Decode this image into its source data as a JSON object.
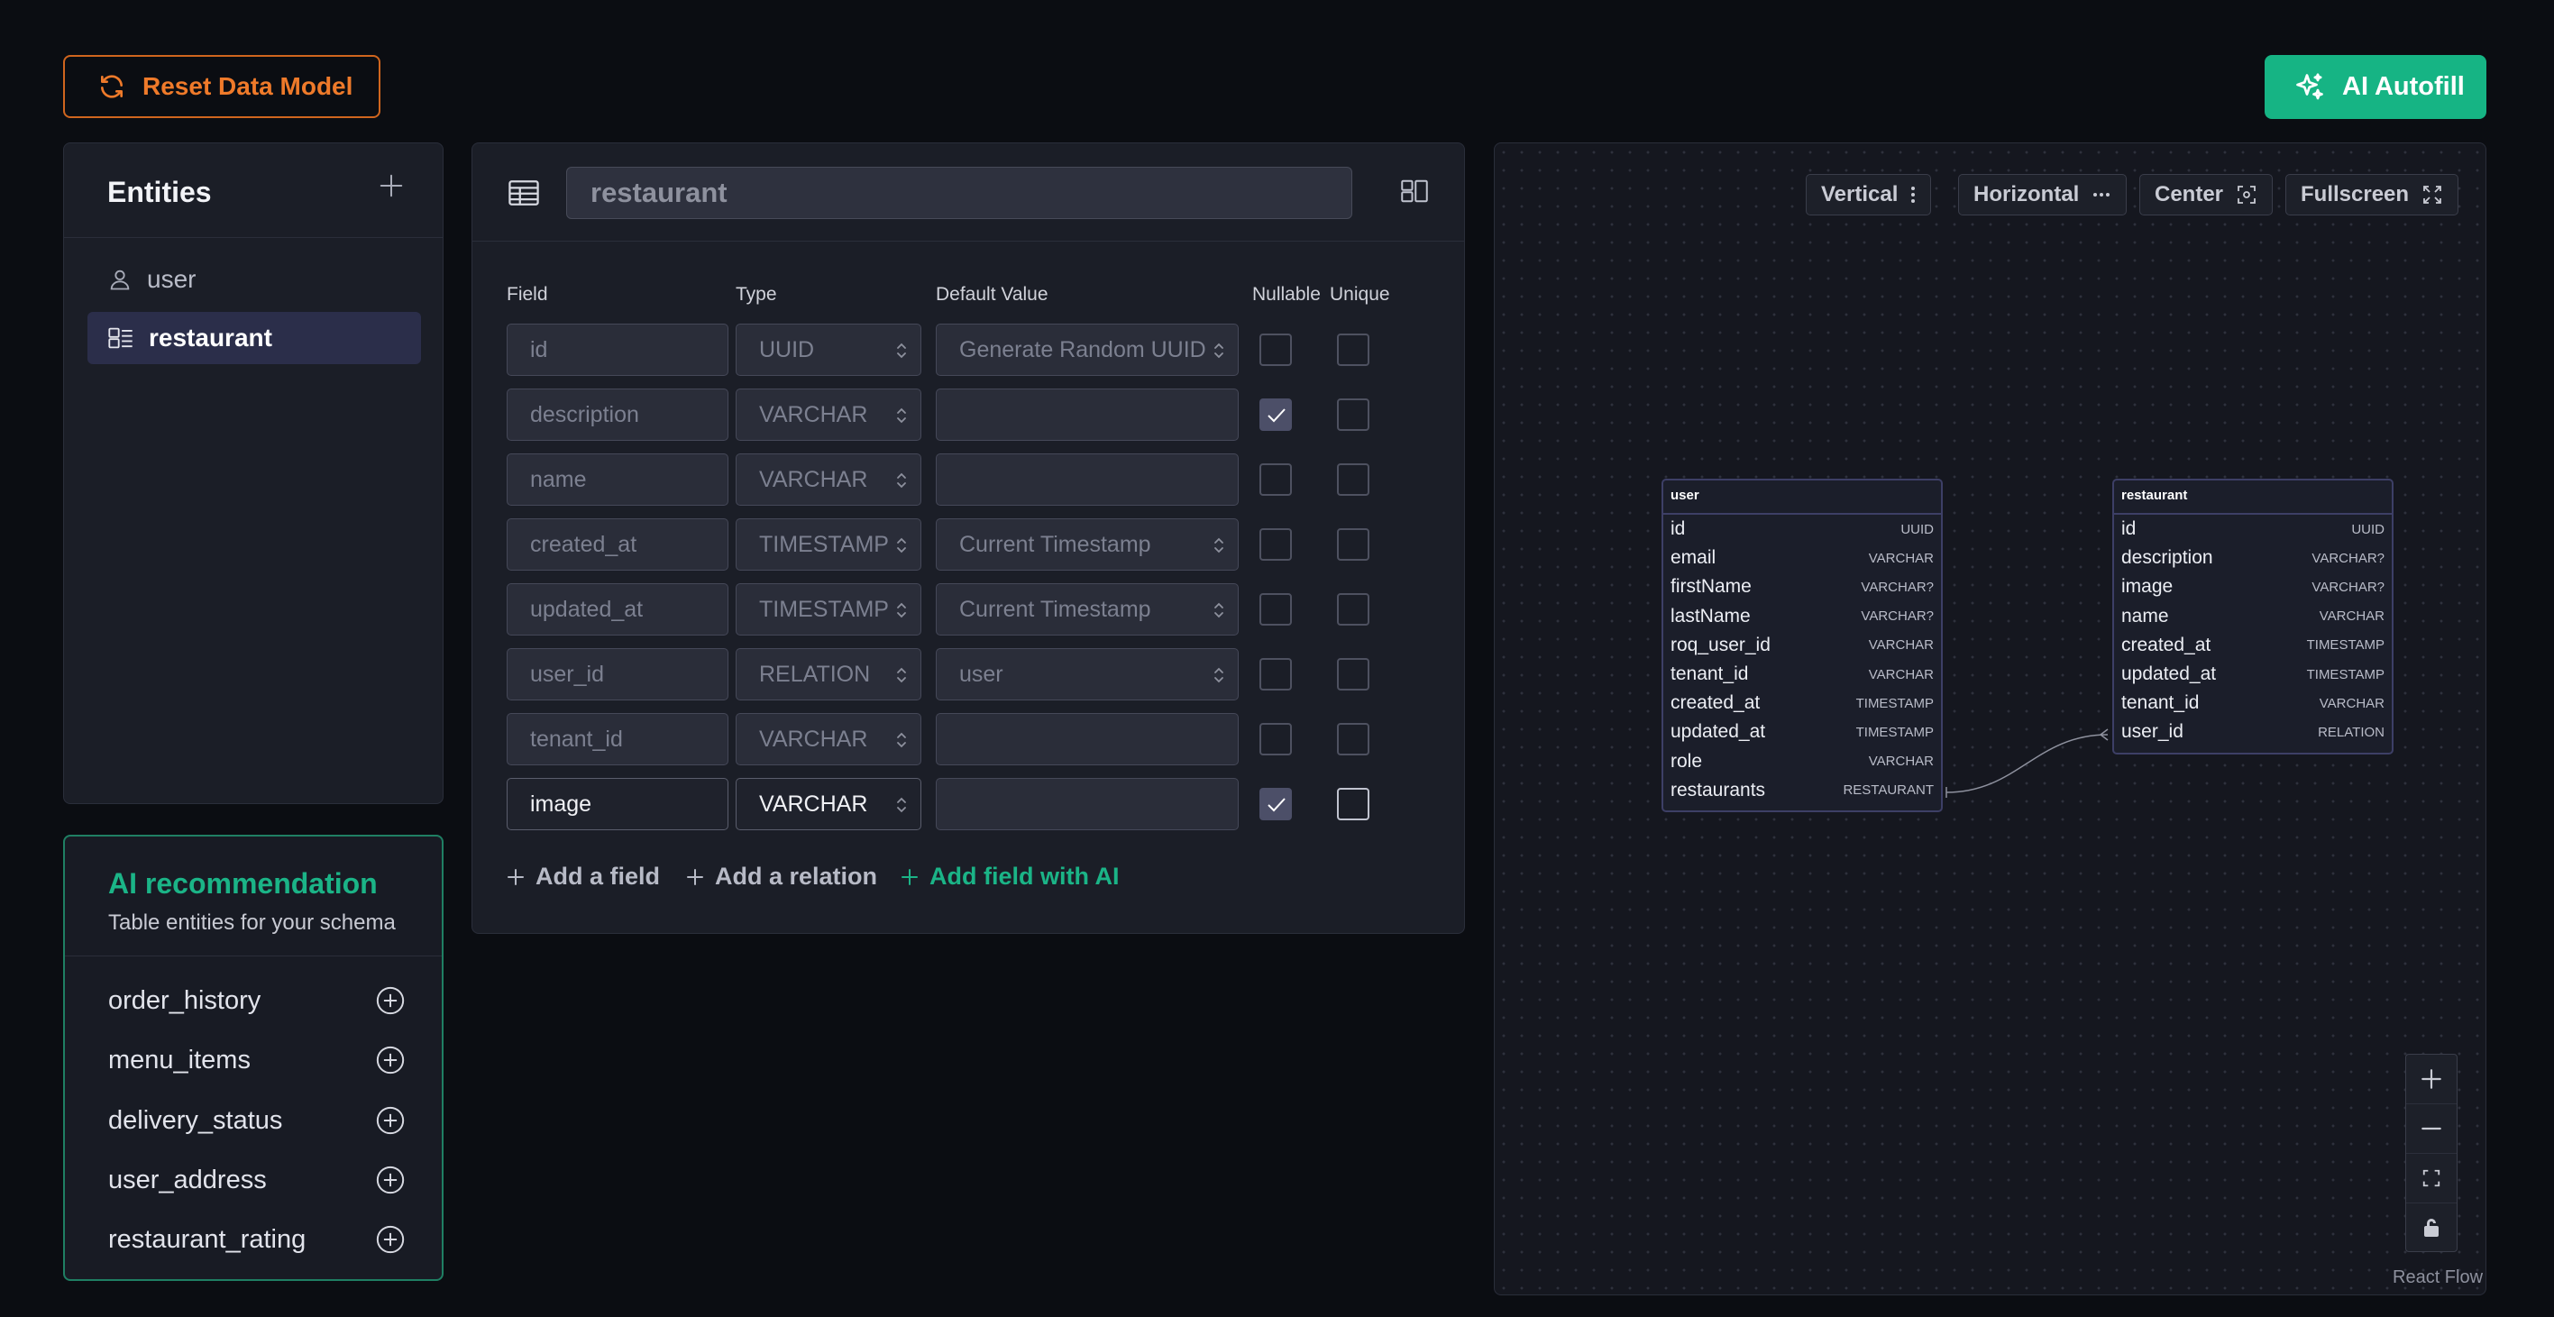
{
  "toolbar": {
    "reset_label": "Reset Data Model",
    "ai_autofill_label": "AI Autofill"
  },
  "entities": {
    "title": "Entities",
    "items": [
      {
        "label": "user",
        "icon": "person-icon"
      },
      {
        "label": "restaurant",
        "icon": "layout-icon",
        "active": true
      }
    ]
  },
  "ai_recommendation": {
    "title": "AI recommendation",
    "subtitle": "Table entities for your schema",
    "items": [
      "order_history",
      "menu_items",
      "delivery_status",
      "user_address",
      "restaurant_rating"
    ]
  },
  "editor": {
    "entity_name": "restaurant",
    "columns": {
      "field": "Field",
      "type": "Type",
      "default": "Default Value",
      "nullable": "Nullable",
      "unique": "Unique"
    },
    "rows": [
      {
        "field": "id",
        "type": "UUID",
        "default": "Generate Random UUID",
        "nullable": false,
        "unique": false,
        "active": false
      },
      {
        "field": "description",
        "type": "VARCHAR",
        "default": "",
        "nullable": true,
        "unique": false,
        "active": false
      },
      {
        "field": "name",
        "type": "VARCHAR",
        "default": "",
        "nullable": false,
        "unique": false,
        "active": false
      },
      {
        "field": "created_at",
        "type": "TIMESTAMP",
        "default": "Current Timestamp",
        "nullable": false,
        "unique": false,
        "active": false
      },
      {
        "field": "updated_at",
        "type": "TIMESTAMP",
        "default": "Current Timestamp",
        "nullable": false,
        "unique": false,
        "active": false
      },
      {
        "field": "user_id",
        "type": "RELATION",
        "default": "user",
        "nullable": false,
        "unique": false,
        "active": false
      },
      {
        "field": "tenant_id",
        "type": "VARCHAR",
        "default": "",
        "nullable": false,
        "unique": false,
        "active": false
      },
      {
        "field": "image",
        "type": "VARCHAR",
        "default": "",
        "nullable": true,
        "unique": false,
        "active": true
      }
    ],
    "add_field": "Add a field",
    "add_relation": "Add a relation",
    "add_field_ai": "Add field with AI"
  },
  "canvas": {
    "buttons": {
      "vertical": "Vertical",
      "horizontal": "Horizontal",
      "center": "Center",
      "fullscreen": "Fullscreen"
    },
    "attribution": "React Flow",
    "nodes": {
      "user": {
        "title": "user",
        "fields": [
          {
            "name": "id",
            "type": "UUID"
          },
          {
            "name": "email",
            "type": "VARCHAR"
          },
          {
            "name": "firstName",
            "type": "VARCHAR?"
          },
          {
            "name": "lastName",
            "type": "VARCHAR?"
          },
          {
            "name": "roq_user_id",
            "type": "VARCHAR"
          },
          {
            "name": "tenant_id",
            "type": "VARCHAR"
          },
          {
            "name": "created_at",
            "type": "TIMESTAMP"
          },
          {
            "name": "updated_at",
            "type": "TIMESTAMP"
          },
          {
            "name": "role",
            "type": "VARCHAR"
          },
          {
            "name": "restaurants",
            "type": "RESTAURANT"
          }
        ]
      },
      "restaurant": {
        "title": "restaurant",
        "fields": [
          {
            "name": "id",
            "type": "UUID"
          },
          {
            "name": "description",
            "type": "VARCHAR?"
          },
          {
            "name": "image",
            "type": "VARCHAR?"
          },
          {
            "name": "name",
            "type": "VARCHAR"
          },
          {
            "name": "created_at",
            "type": "TIMESTAMP"
          },
          {
            "name": "updated_at",
            "type": "TIMESTAMP"
          },
          {
            "name": "tenant_id",
            "type": "VARCHAR"
          },
          {
            "name": "user_id",
            "type": "RELATION"
          }
        ]
      }
    }
  },
  "colors": {
    "accent_orange": "#ef7a2a",
    "accent_green": "#16b484",
    "active_item": "#2b2e4a"
  }
}
